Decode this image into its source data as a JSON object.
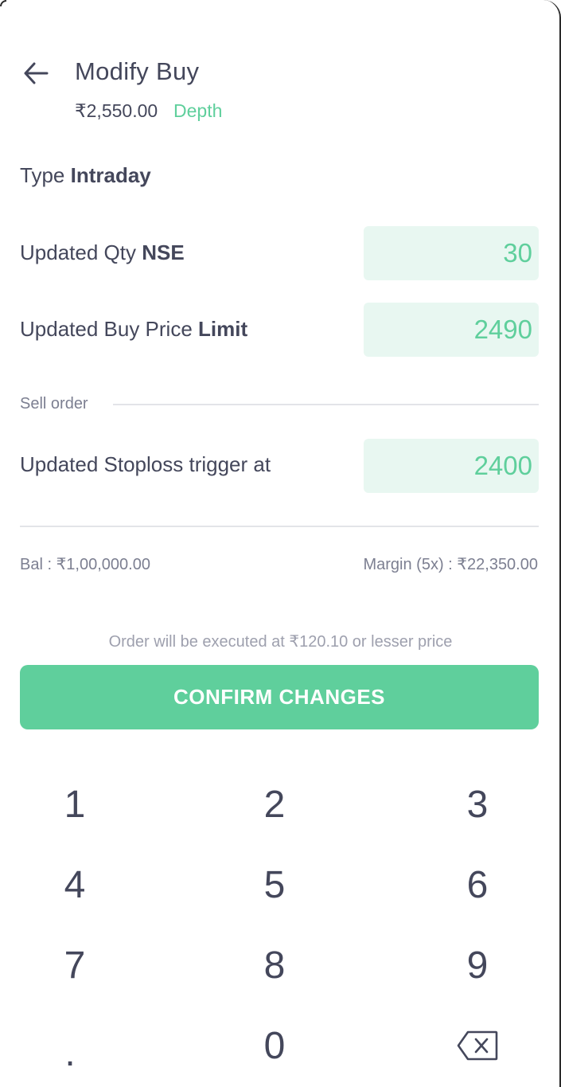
{
  "header": {
    "title": "Modify Buy",
    "price": "₹2,550.00",
    "depth_link": "Depth"
  },
  "order": {
    "type_label": "Type",
    "type_value": "Intraday",
    "qty_label": "Updated Qty",
    "qty_exchange": "NSE",
    "qty_value": "30",
    "price_label": "Updated Buy Price",
    "price_type": "Limit",
    "price_value": "2490"
  },
  "sell_order": {
    "section_label": "Sell order",
    "stoploss_label": "Updated Stoploss trigger at",
    "stoploss_value": "2400"
  },
  "summary": {
    "balance": "Bal :  ₹1,00,000.00",
    "margin": "Margin (5x) :  ₹22,350.00",
    "note": "Order will be executed at ₹120.10 or lesser price"
  },
  "confirm_button": "CONFIRM CHANGES",
  "keypad": {
    "k1": "1",
    "k2": "2",
    "k3": "3",
    "k4": "4",
    "k5": "5",
    "k6": "6",
    "k7": "7",
    "k8": "8",
    "k9": "9",
    "kdot": ".",
    "k0": "0",
    "backspace_icon": "backspace-icon"
  },
  "colors": {
    "accent": "#5fcf9c",
    "input_bg": "#e8f7f1",
    "text": "#44475b",
    "muted": "#7c7f91"
  }
}
